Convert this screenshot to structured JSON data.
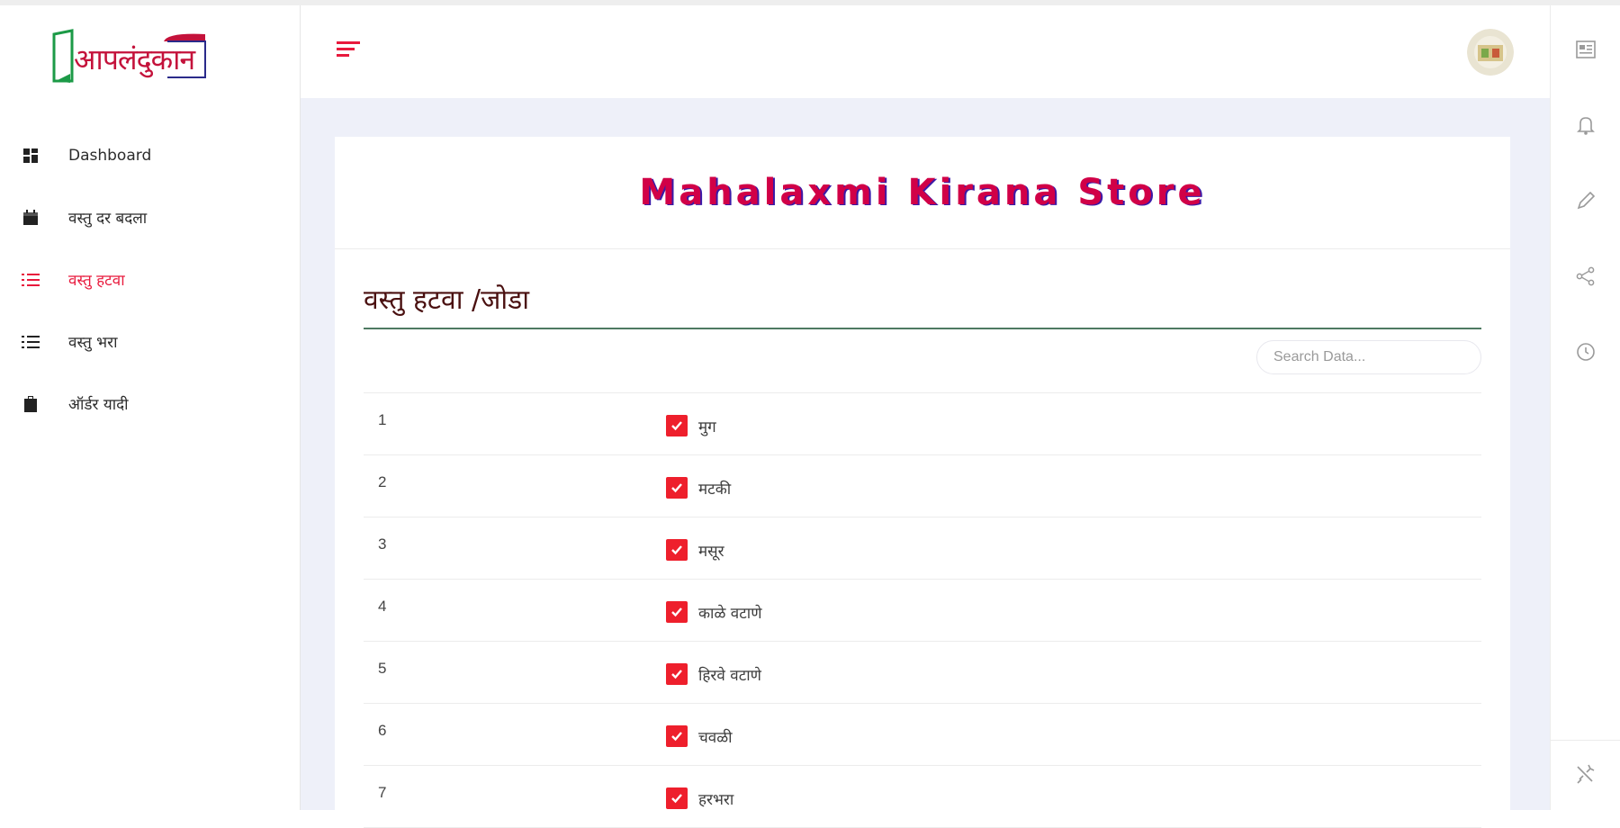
{
  "logo": {
    "text": "आपलंदुकान"
  },
  "sidebar": {
    "items": [
      {
        "label": "Dashboard",
        "icon": "dashboard-icon",
        "active": false
      },
      {
        "label": "वस्तु दर बदला",
        "icon": "calendar-icon",
        "active": false
      },
      {
        "label": "वस्तु हटवा",
        "icon": "list-icon",
        "active": true
      },
      {
        "label": "वस्तु भरा",
        "icon": "list-icon",
        "active": false
      },
      {
        "label": "ऑर्डर यादी",
        "icon": "clipboard-icon",
        "active": false
      }
    ]
  },
  "header": {
    "menu_icon": "hamburger-menu-icon",
    "avatar": "user-avatar"
  },
  "card": {
    "store_name": "Mahalaxmi Kirana Store",
    "section_title": "वस्तु हटवा /जोडा",
    "search": {
      "placeholder": "Search Data...",
      "value": ""
    },
    "rows": [
      {
        "num": "1",
        "name": "मुग",
        "checked": true
      },
      {
        "num": "2",
        "name": "मटकी",
        "checked": true
      },
      {
        "num": "3",
        "name": "मसूर",
        "checked": true
      },
      {
        "num": "4",
        "name": "काळे वटाणे",
        "checked": true
      },
      {
        "num": "5",
        "name": "हिरवे वटाणे",
        "checked": true
      },
      {
        "num": "6",
        "name": "चवळी",
        "checked": true
      },
      {
        "num": "7",
        "name": "हरभरा",
        "checked": true
      }
    ]
  },
  "right_rail": {
    "icons": [
      "news-icon",
      "bell-icon",
      "pencil-icon",
      "share-icon",
      "clock-icon",
      "settings-tool-icon"
    ]
  },
  "colors": {
    "accent": "#e8193c",
    "checkbox": "#ee1f2c",
    "store_name": "#d10047",
    "divider": "#4e7a62",
    "background": "#eef0f9"
  }
}
